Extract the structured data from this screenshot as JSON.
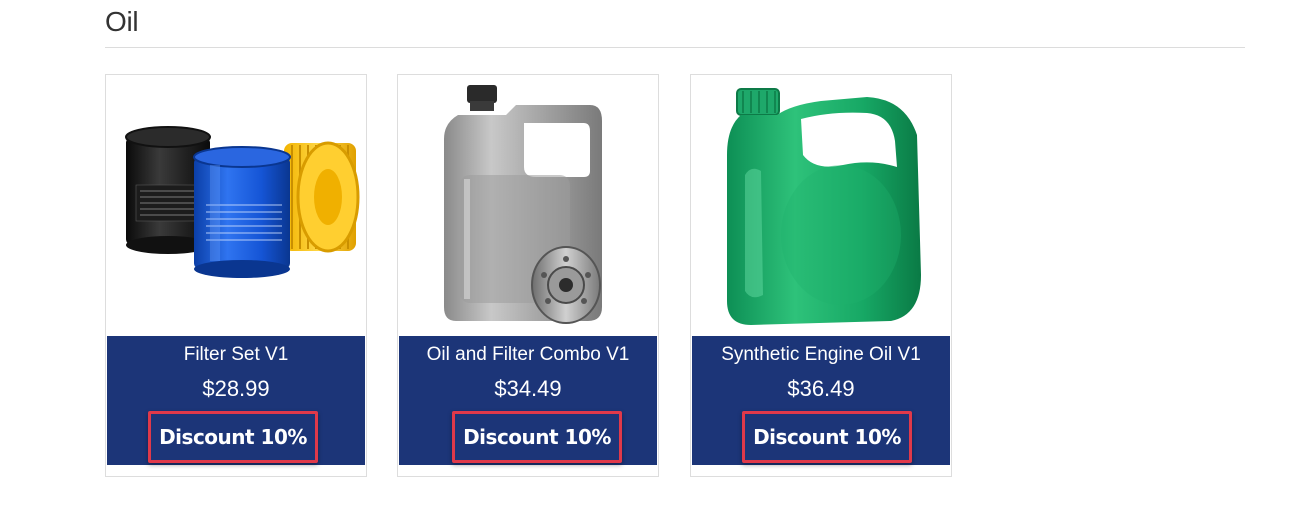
{
  "section": {
    "title": "Oil"
  },
  "products": [
    {
      "name": "Filter Set V1",
      "price": "$28.99",
      "discount": "Discount 10%",
      "image_icon": "oil-filter-set-image"
    },
    {
      "name": "Oil and Filter Combo V1",
      "price": "$34.49",
      "discount": "Discount 10%",
      "image_icon": "oil-jug-with-filter-image"
    },
    {
      "name": "Synthetic Engine Oil V1",
      "price": "$36.49",
      "discount": "Discount 10%",
      "image_icon": "green-oil-jug-image"
    }
  ],
  "colors": {
    "info_panel": "#1c3578",
    "discount_border": "#e0394a",
    "divider": "#dcdcdc"
  }
}
